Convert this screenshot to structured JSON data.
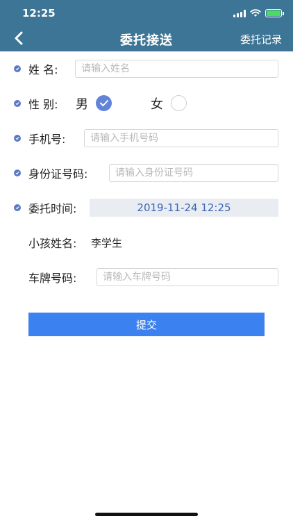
{
  "status_bar": {
    "time": "12:25"
  },
  "header": {
    "title": "委托接送",
    "right_link": "委托记录"
  },
  "form": {
    "name": {
      "label": "姓 名:",
      "placeholder": "请输入姓名"
    },
    "gender": {
      "label": "性 别:",
      "male": "男",
      "female": "女",
      "selected": "男"
    },
    "phone": {
      "label": "手机号:",
      "placeholder": "请输入手机号码"
    },
    "id_card": {
      "label": "身份证号码:",
      "placeholder": "请输入身份证号码"
    },
    "entrust_time": {
      "label": "委托时间:",
      "value": "2019-11-24 12:25"
    },
    "child_name": {
      "label": "小孩姓名:",
      "value": "李学生"
    },
    "plate": {
      "label": "车牌号码:",
      "placeholder": "请输入车牌号码"
    }
  },
  "submit_label": "提交",
  "colors": {
    "header_bg": "#3d7596",
    "accent": "#6184d9",
    "button": "#3b82f0",
    "time_text": "#3b66b4"
  }
}
